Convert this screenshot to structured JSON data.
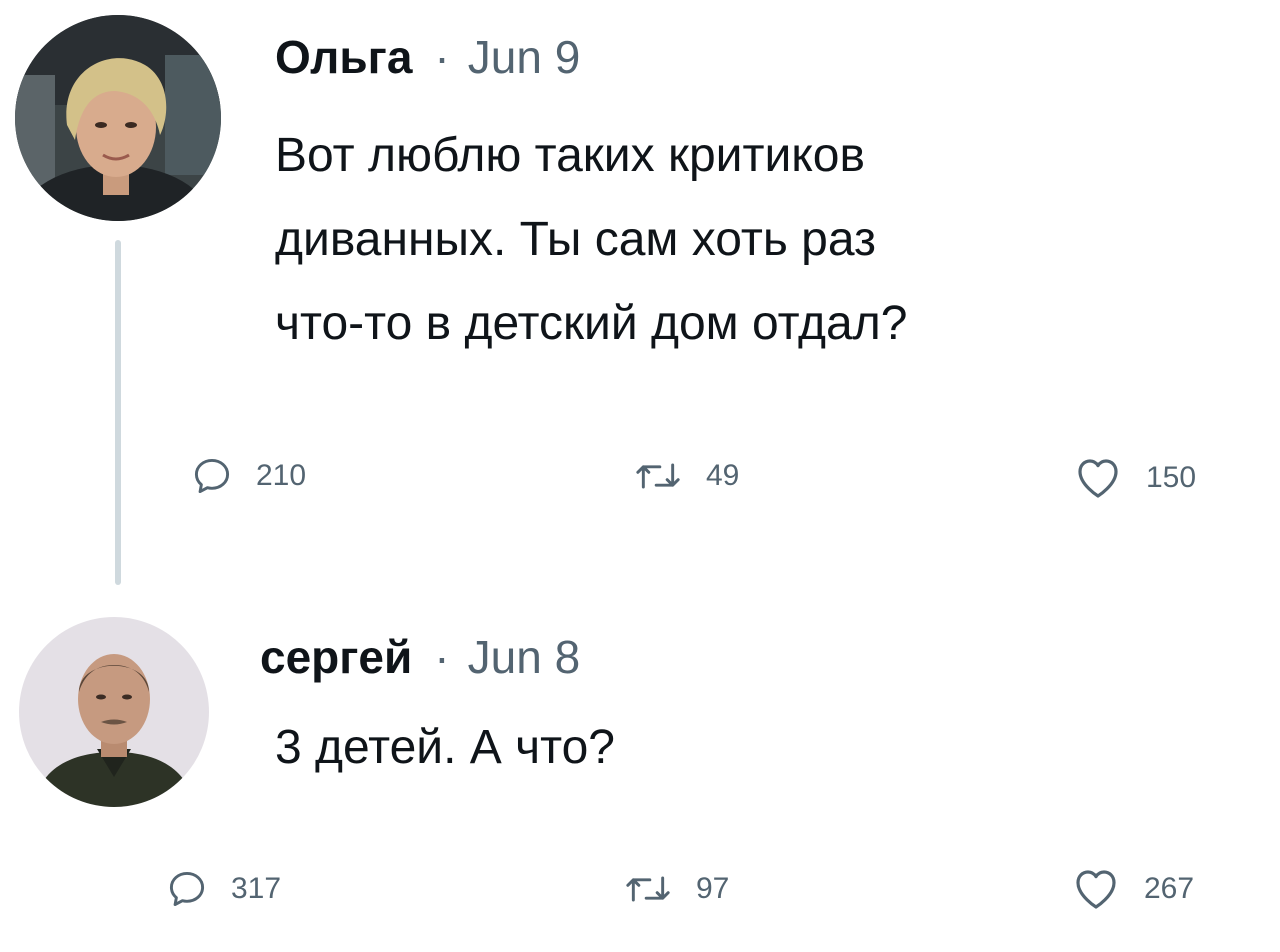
{
  "tweets": [
    {
      "author": "Ольга",
      "separator": "·",
      "date": "Jun 9",
      "text": "Вот люблю таких критиков\nдиванных. Ты сам хоть раз\nчто-то в детский дом отдал?",
      "replies": "210",
      "retweets": "49",
      "likes": "150"
    },
    {
      "author": "сергей",
      "separator": "·",
      "date": "Jun 8",
      "text": "3 детей. А что?",
      "replies": "317",
      "retweets": "97",
      "likes": "267"
    }
  ],
  "icons": {
    "reply": "reply-icon",
    "retweet": "retweet-icon",
    "like": "heart-icon"
  },
  "colors": {
    "text": "#0f1419",
    "secondary": "#536471",
    "thread_line": "#cfd9de"
  }
}
